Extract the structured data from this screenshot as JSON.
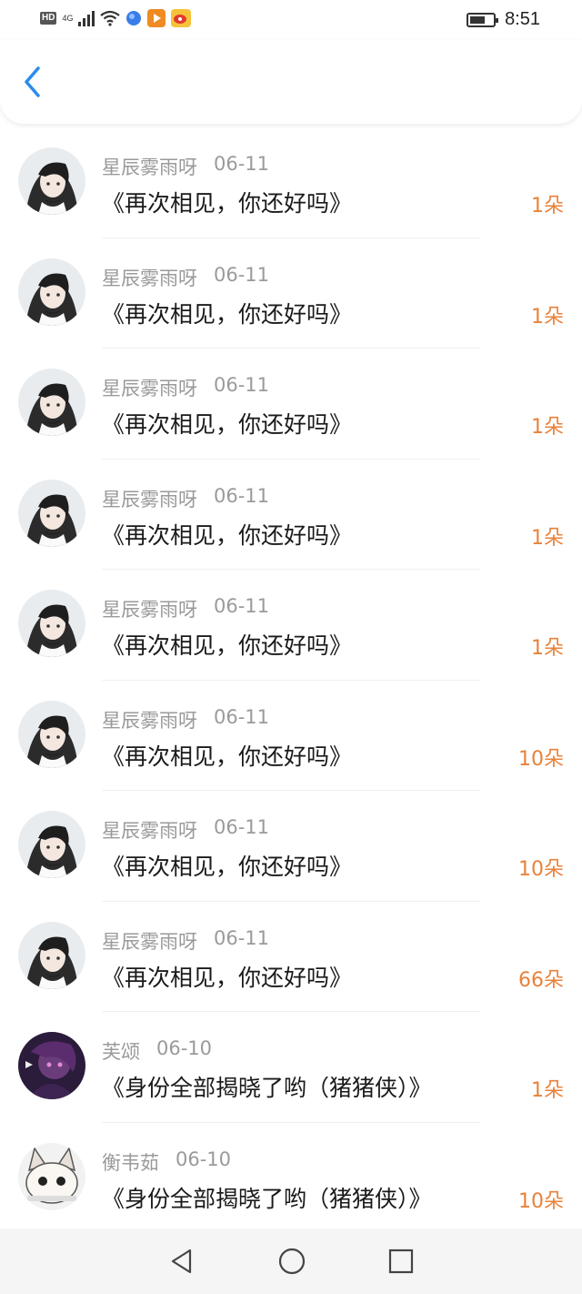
{
  "status_bar": {
    "hd": "HD",
    "network": "4G",
    "time": "8:51",
    "battery_level": 0.65,
    "icons": [
      "hd-icon",
      "signal-icon",
      "wifi-icon",
      "app-icon",
      "video-app-icon",
      "weibo-icon",
      "battery-icon"
    ]
  },
  "header": {
    "back_icon": "chevron-left-icon"
  },
  "colors": {
    "accent": "#e8823a",
    "back": "#2a8cf0",
    "name": "#9a9a9a"
  },
  "items": [
    {
      "name": "星辰雾雨呀",
      "date": "06-11",
      "title": "《再次相见，你还好吗》",
      "count": "1朵",
      "avatar": "girl"
    },
    {
      "name": "星辰雾雨呀",
      "date": "06-11",
      "title": "《再次相见，你还好吗》",
      "count": "1朵",
      "avatar": "girl"
    },
    {
      "name": "星辰雾雨呀",
      "date": "06-11",
      "title": "《再次相见，你还好吗》",
      "count": "1朵",
      "avatar": "girl"
    },
    {
      "name": "星辰雾雨呀",
      "date": "06-11",
      "title": "《再次相见，你还好吗》",
      "count": "1朵",
      "avatar": "girl"
    },
    {
      "name": "星辰雾雨呀",
      "date": "06-11",
      "title": "《再次相见，你还好吗》",
      "count": "1朵",
      "avatar": "girl"
    },
    {
      "name": "星辰雾雨呀",
      "date": "06-11",
      "title": "《再次相见，你还好吗》",
      "count": "10朵",
      "avatar": "girl"
    },
    {
      "name": "星辰雾雨呀",
      "date": "06-11",
      "title": "《再次相见，你还好吗》",
      "count": "10朵",
      "avatar": "girl"
    },
    {
      "name": "星辰雾雨呀",
      "date": "06-11",
      "title": "《再次相见，你还好吗》",
      "count": "66朵",
      "avatar": "girl"
    },
    {
      "name": "芙颂",
      "date": "06-10",
      "title": "《身份全部揭晓了哟（猪猪侠）》",
      "count": "1朵",
      "avatar": "dark"
    },
    {
      "name": "衡韦茹",
      "date": "06-10",
      "title": "《身份全部揭晓了哟（猪猪侠）》",
      "count": "10朵",
      "avatar": "cat"
    }
  ],
  "nav": [
    "back-triangle-icon",
    "home-circle-icon",
    "recents-square-icon"
  ]
}
